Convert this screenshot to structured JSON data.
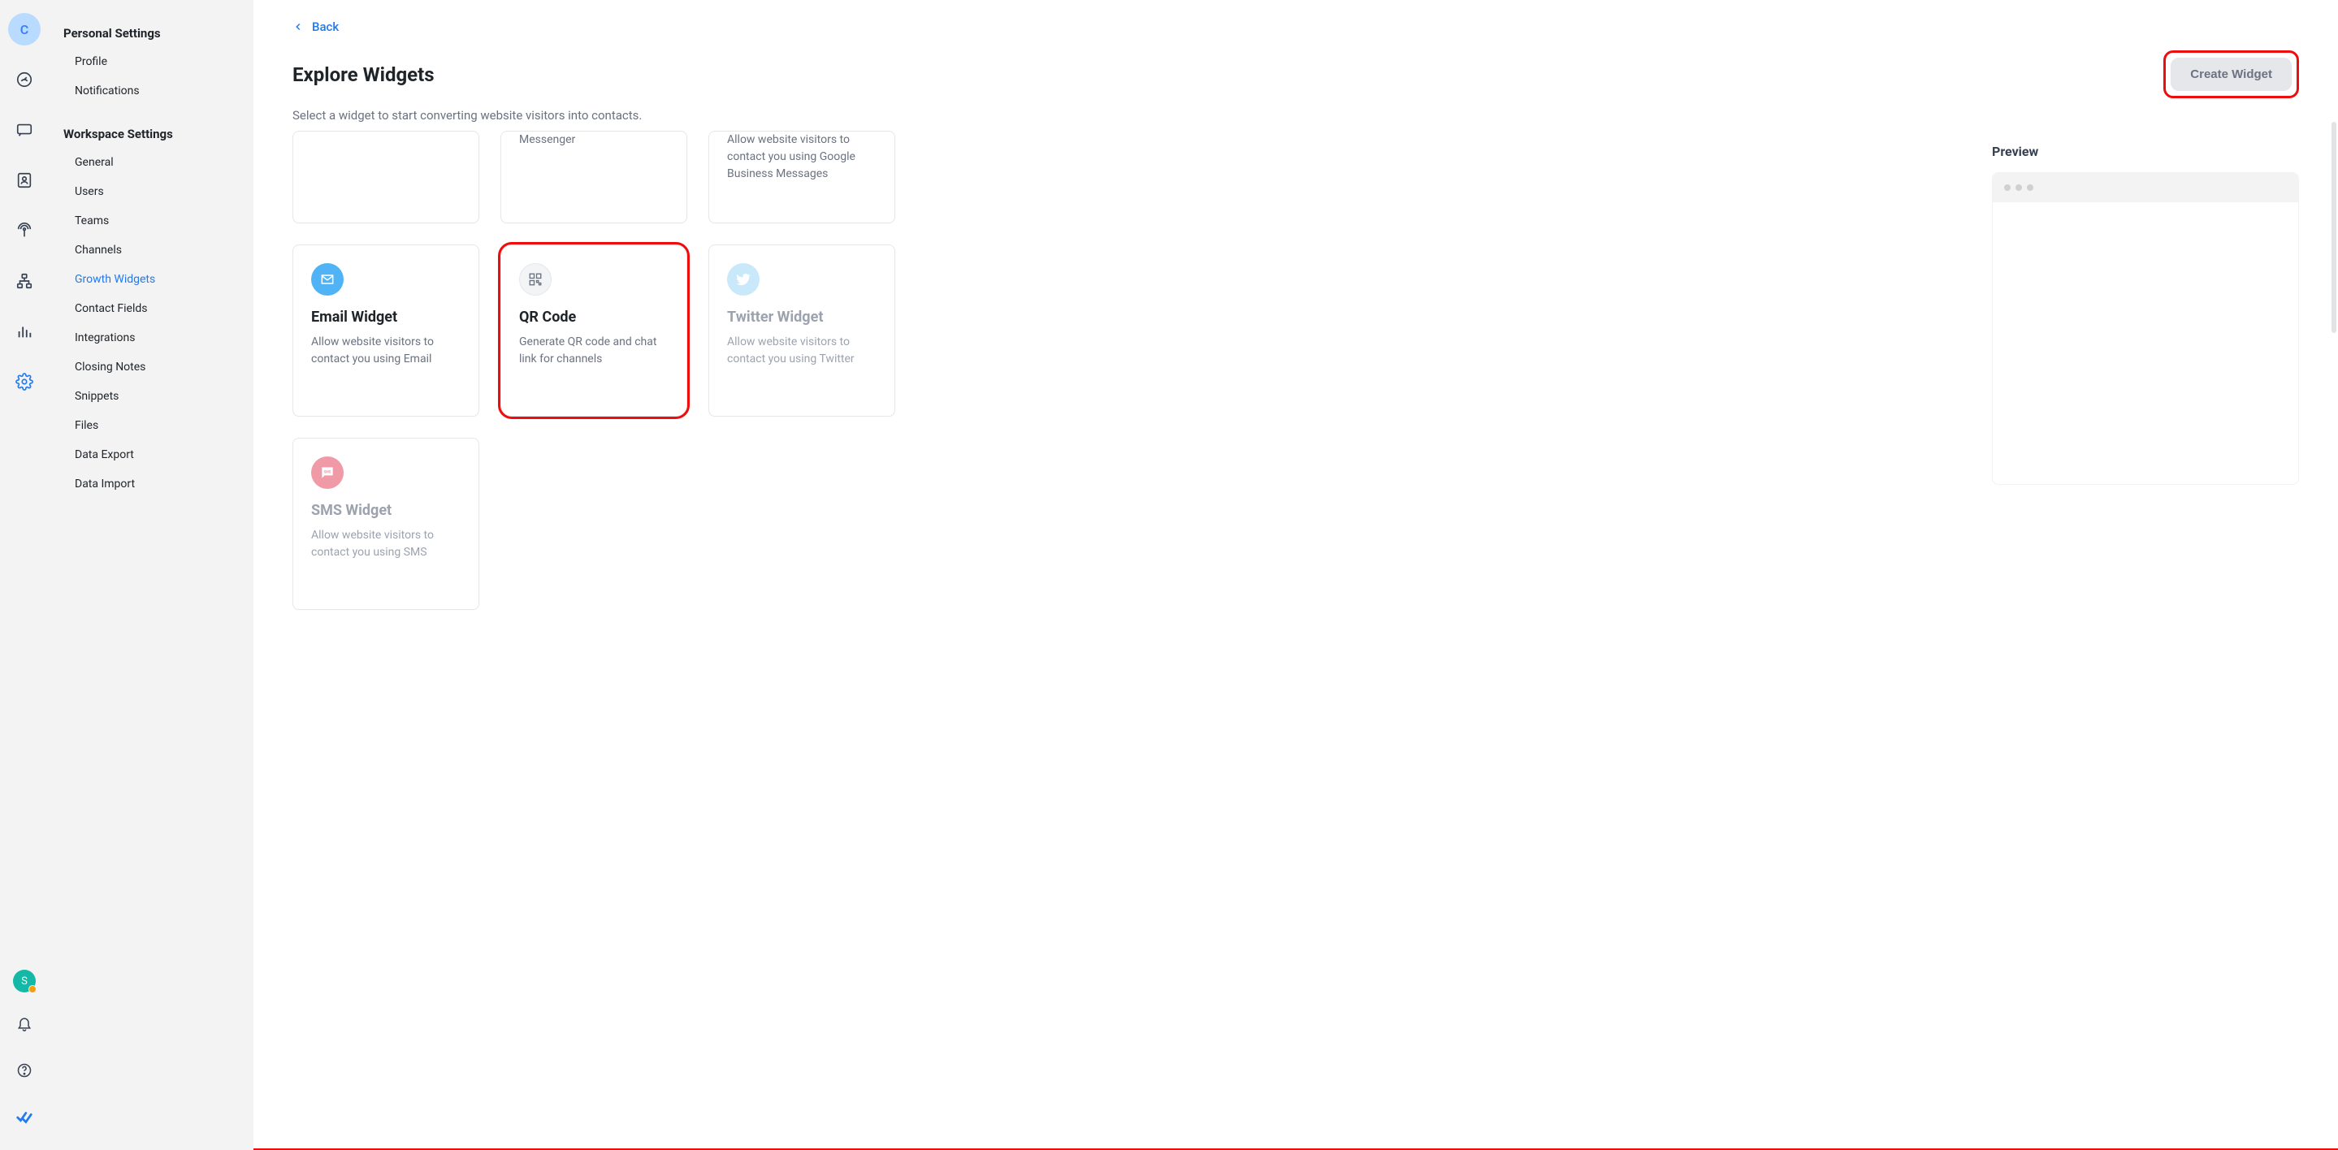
{
  "rail": {
    "top_avatar_letter": "C",
    "bottom_avatar_letter": "S"
  },
  "sidebar": {
    "personal_title": "Personal Settings",
    "personal_items": [
      "Profile",
      "Notifications"
    ],
    "workspace_title": "Workspace Settings",
    "workspace_items": [
      "General",
      "Users",
      "Teams",
      "Channels",
      "Growth Widgets",
      "Contact Fields",
      "Integrations",
      "Closing Notes",
      "Snippets",
      "Files",
      "Data Export",
      "Data Import"
    ],
    "active_item": "Growth Widgets"
  },
  "header": {
    "back_label": "Back",
    "title": "Explore Widgets",
    "subtitle": "Select a widget to start converting website visitors into contacts.",
    "create_button": "Create Widget"
  },
  "cards": {
    "row0": [
      {
        "desc_tail": ""
      },
      {
        "desc_tail": "Messenger"
      },
      {
        "desc_tail": "Allow website visitors to contact you using Google Business Messages"
      }
    ],
    "row1": [
      {
        "title": "Email Widget",
        "desc": "Allow website visitors to contact you using Email",
        "icon": "email",
        "disabled": false
      },
      {
        "title": "QR Code",
        "desc": "Generate QR code and chat link for channels",
        "icon": "qr",
        "disabled": false,
        "highlighted": true
      },
      {
        "title": "Twitter Widget",
        "desc": "Allow website visitors to contact you using Twitter",
        "icon": "twitter",
        "disabled": true
      }
    ],
    "row2": [
      {
        "title": "SMS Widget",
        "desc": "Allow website visitors to contact you using SMS",
        "icon": "sms",
        "disabled": true
      }
    ]
  },
  "preview": {
    "title": "Preview"
  }
}
